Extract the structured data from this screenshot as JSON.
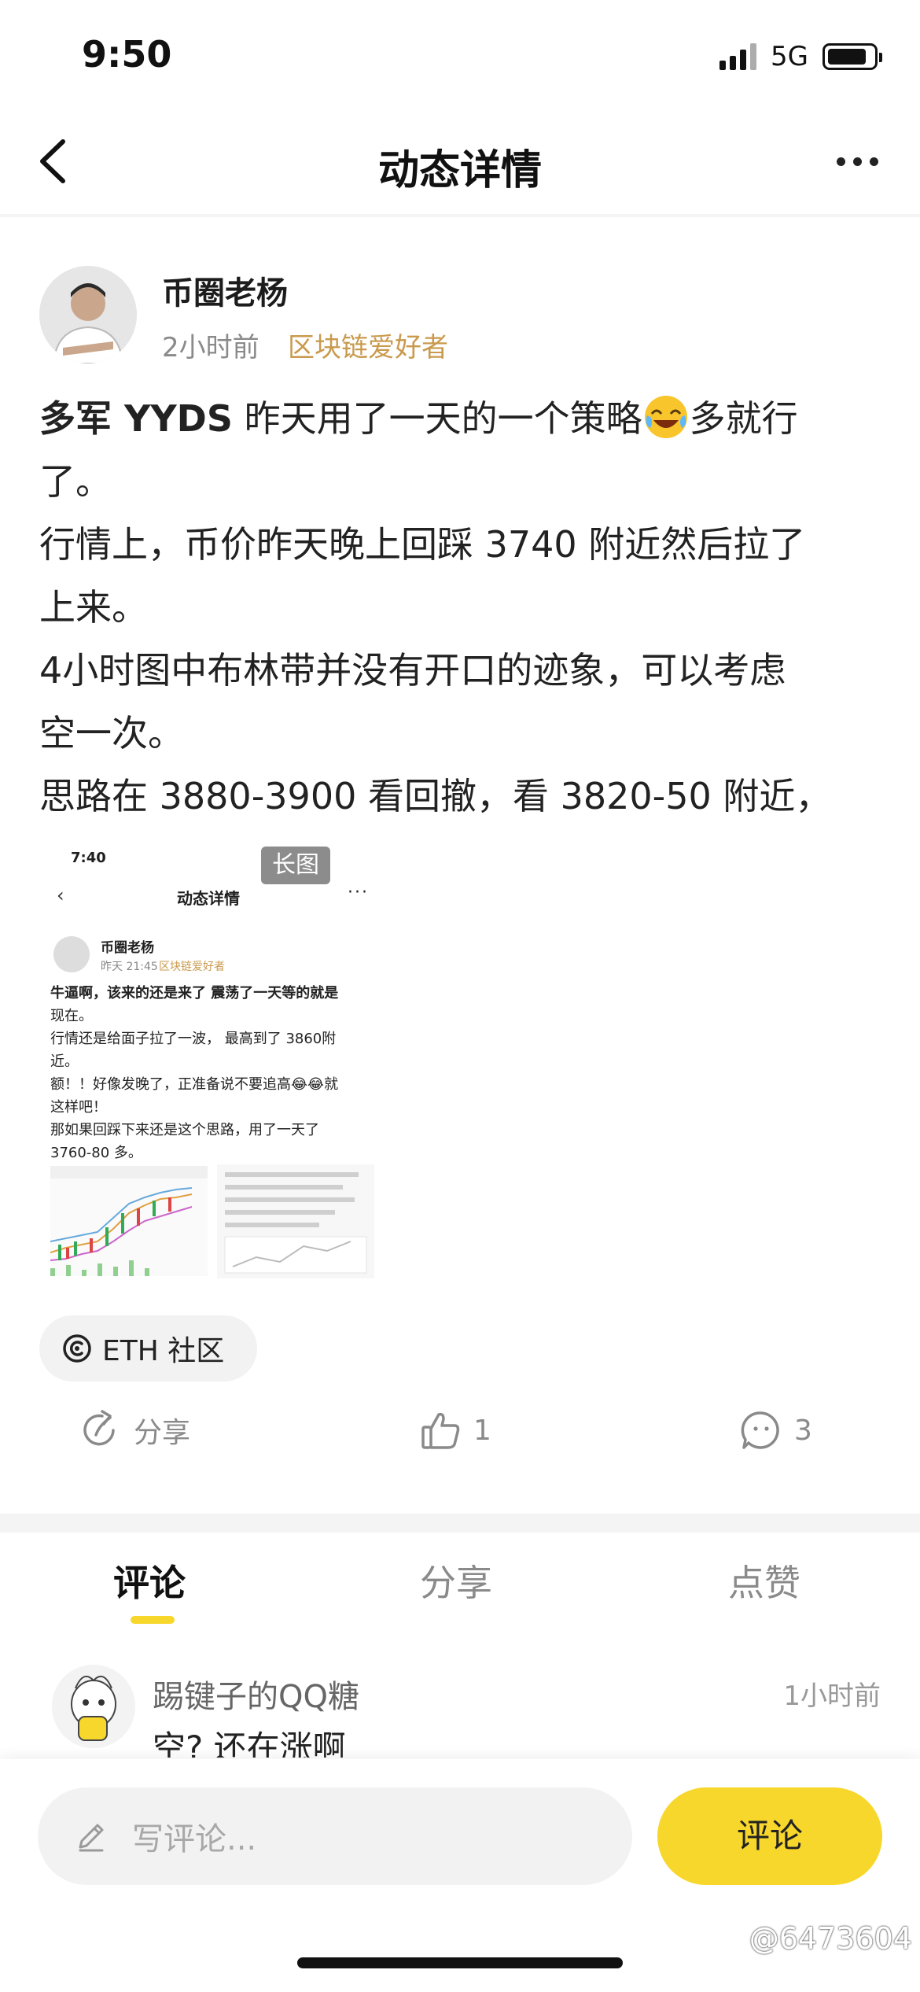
{
  "status_bar": {
    "time": "9:50",
    "network": "5G",
    "battery_level": 0.85
  },
  "nav": {
    "title": "动态详情"
  },
  "post": {
    "author": "币圈老杨",
    "time": "2小时前",
    "tag": "区块链爱好者",
    "lines": [
      {
        "bold": "多军 YYDS",
        "text_before_emoji": " 昨天用了一天的一个策略",
        "emoji": "laughing-tears",
        "text_after_emoji": "多就行"
      },
      "了。",
      "行情上，币价昨天晚上回踩 3740 附近然后拉了",
      "上来。",
      "4小时图中布林带并没有开口的迹象，可以考虑",
      "空一次。",
      "思路在 3880-3900 看回撤，看 3820-50 附近，"
    ],
    "image": {
      "badge": "长图",
      "time": "7:40",
      "title": "动态详情",
      "author": "币圈老杨",
      "post_time": "昨天 21:45",
      "tag": "区块链爱好者",
      "lines": [
        "牛逼啊，该来的还是来了 震荡了一天等的就是",
        "现在。",
        "行情还是给面子拉了一波， 最高到了 3860附",
        "近。",
        "额！！好像发晚了，正准备说不要追高😂😂就",
        "这样吧！",
        "那如果回踩下来还是这个思路，用了一天了",
        "3760-80 多。"
      ]
    },
    "community": "ETH 社区",
    "actions": {
      "share": "分享",
      "likes": "1",
      "comments": "3"
    }
  },
  "tabs": [
    "评论",
    "分享",
    "点赞"
  ],
  "comment": {
    "user": "踢键子的QQ糖",
    "time": "1小时前",
    "text": "空?  还在涨啊"
  },
  "bottom": {
    "placeholder": "写评论...",
    "button": "评论",
    "watermark": "@6473604"
  },
  "colors": {
    "accent": "#f7d72b",
    "tag": "#c99a4d",
    "muted": "#8a8a8a"
  }
}
